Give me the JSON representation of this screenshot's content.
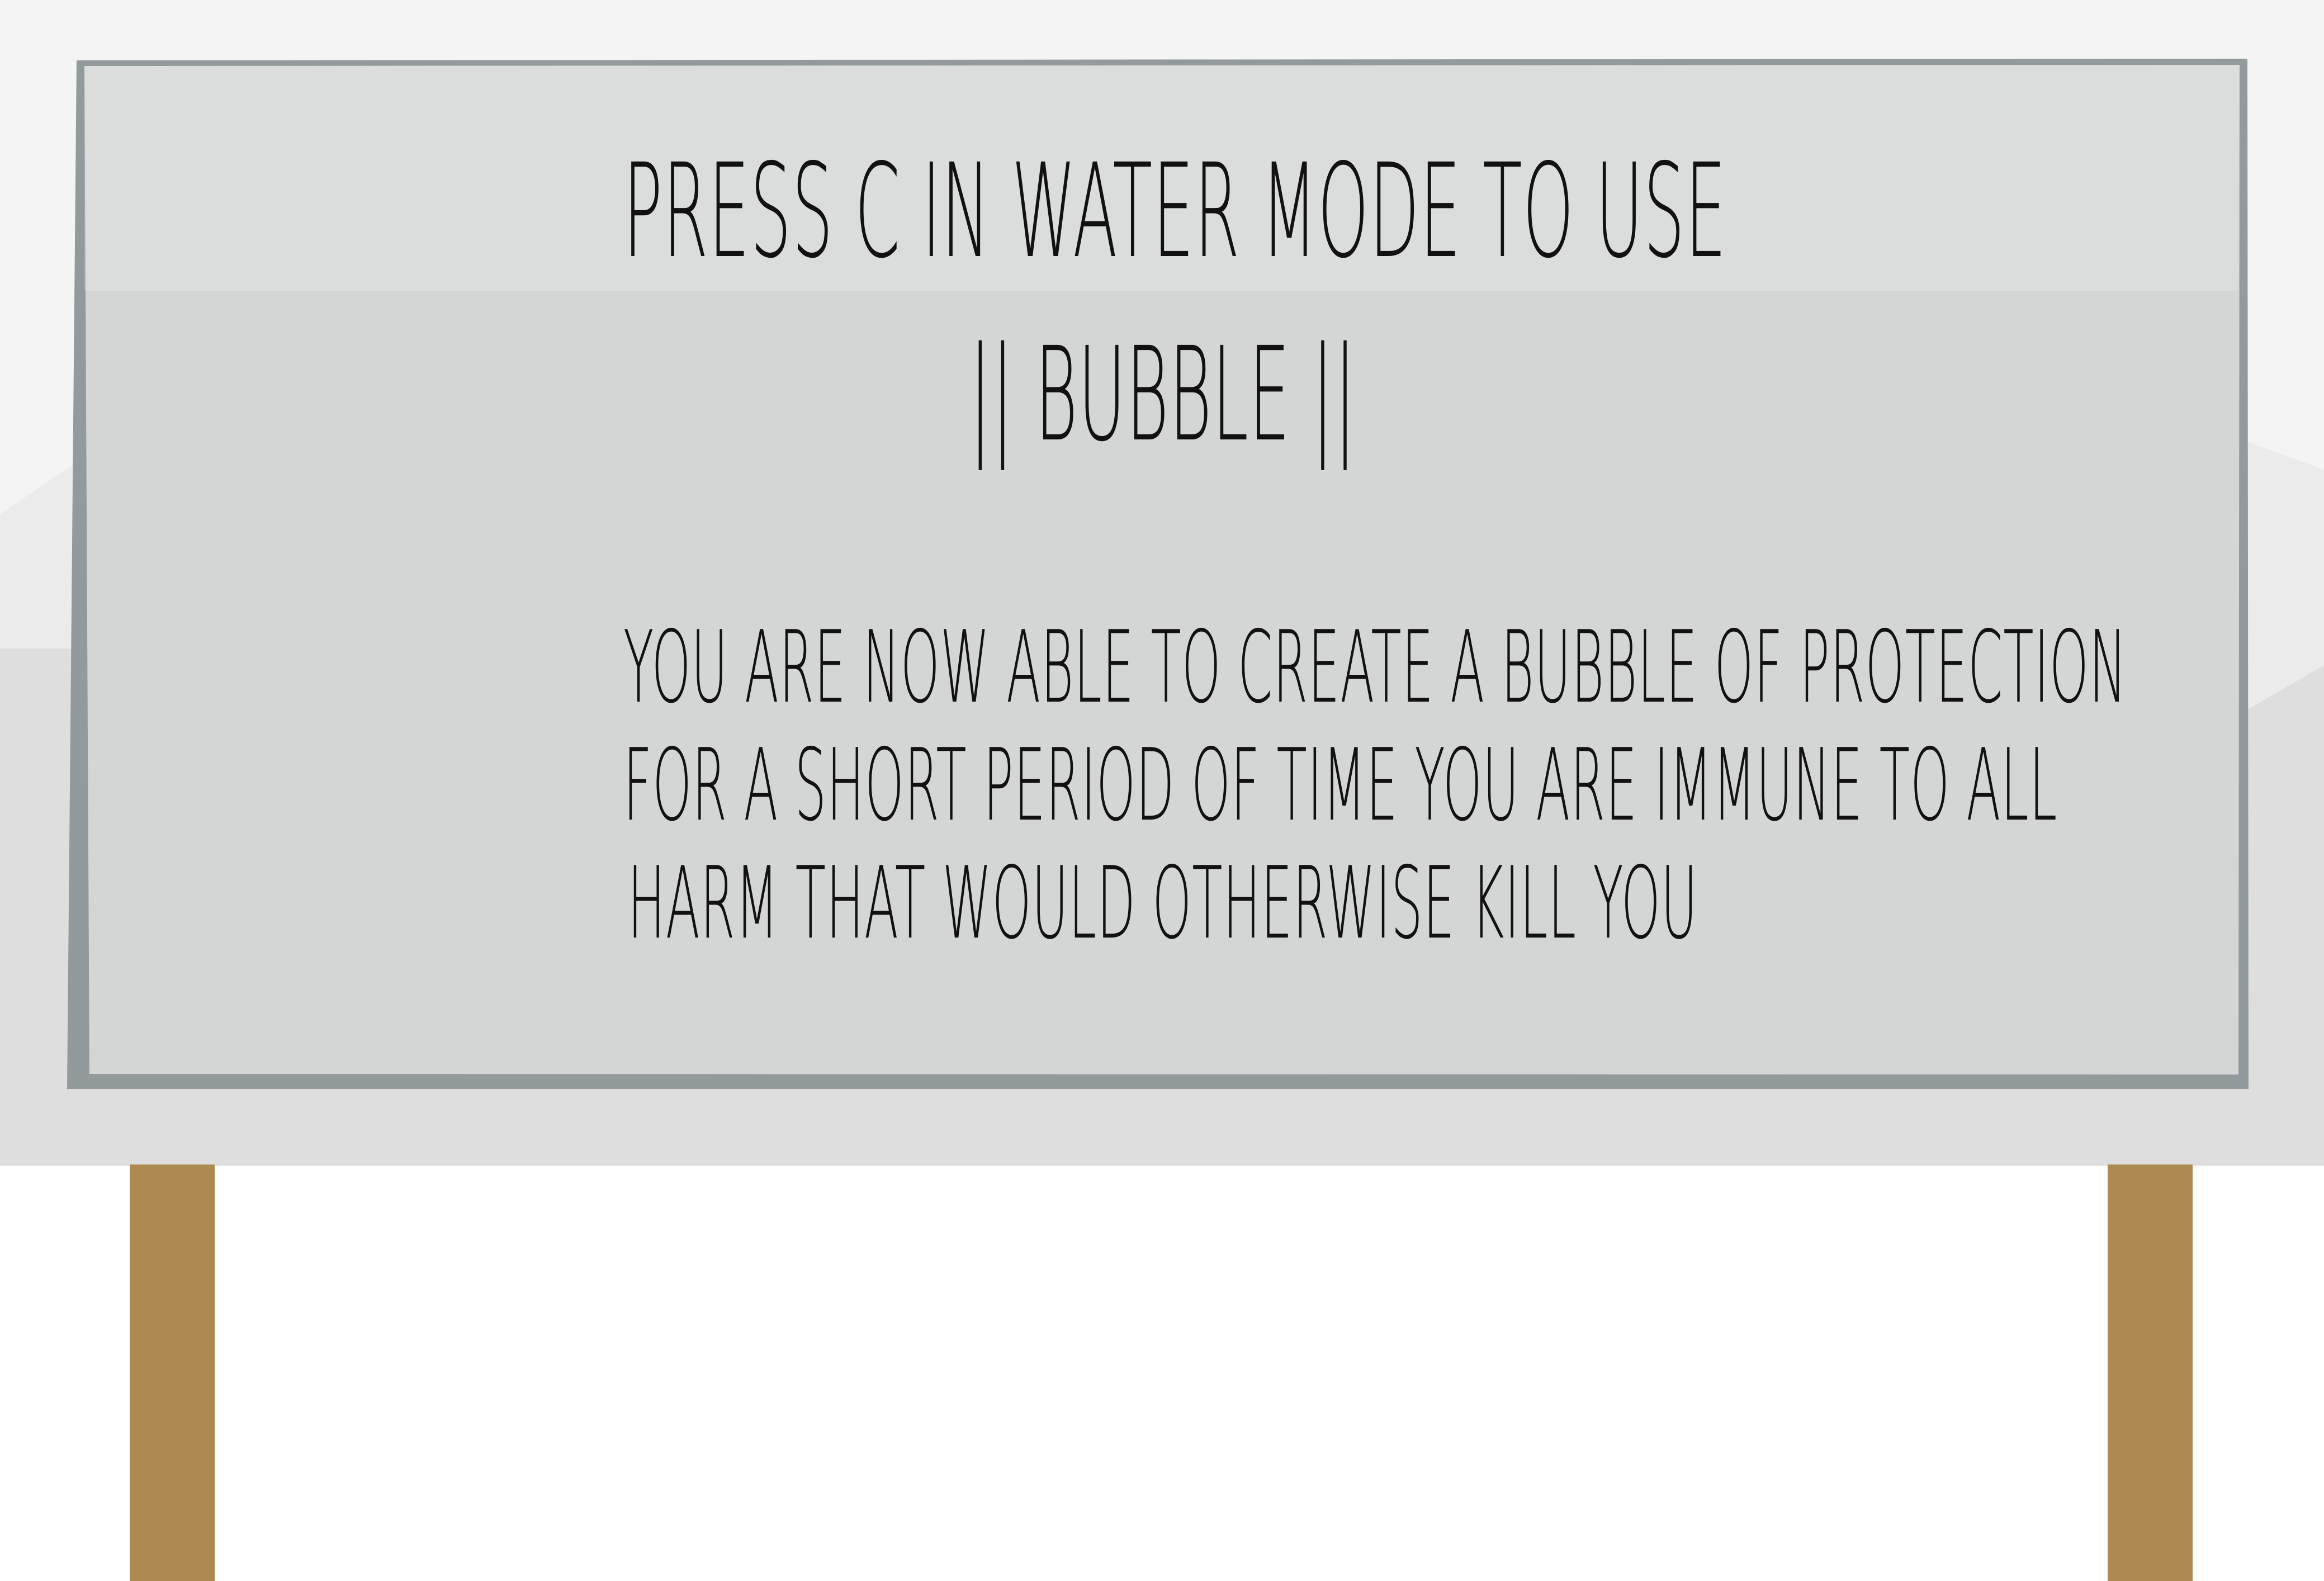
{
  "sign": {
    "title_lines": [
      "PRESS C IN WATER MODE TO USE",
      "|| BUBBLE ||"
    ],
    "body_lines": [
      "YOU ARE NOW ABLE TO CREATE A BUBBLE OF PROTECTION",
      "FOR A SHORT PERIOD OF TIME YOU ARE IMMUNE TO ALL",
      "HARM THAT WOULD OTHERWISE KILL YOU"
    ]
  },
  "colors": {
    "sky": "#f4f4f4",
    "far_mountains": "#ebebeb",
    "near_mountains": "#dedede",
    "board_frame": "#939a9c",
    "board_face": "#ececec",
    "post": "#ad8a4f",
    "text": "#111111"
  }
}
